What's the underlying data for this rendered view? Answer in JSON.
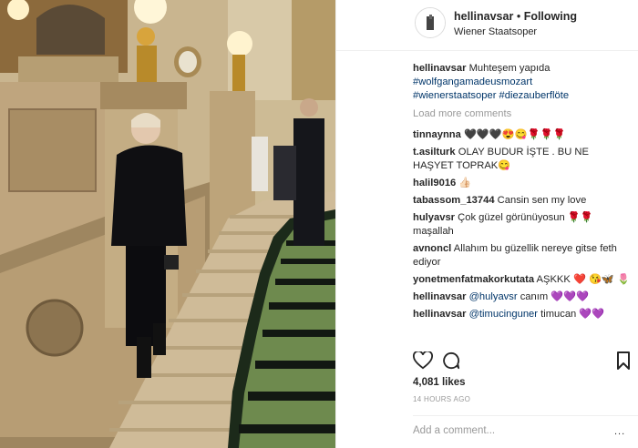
{
  "post": {
    "username": "hellinavsar",
    "separator": "•",
    "follow_status": "Following",
    "location": "Wiener Staatsoper"
  },
  "caption": {
    "username": "hellinavsar",
    "text": "Muhteşem yapıda",
    "hashtags": [
      "#wolfgangamadeusmozart",
      "#wienerstaatsoper",
      "#diezauberflöte"
    ]
  },
  "load_more": "Load more comments",
  "comments": [
    {
      "username": "tinnaynna",
      "text": "🖤🖤🖤😍😋🌹🌹🌹"
    },
    {
      "username": "t.asilturk",
      "text": "OLAY BUDUR İŞTE . BU NE HAŞYET TOPRAK😋"
    },
    {
      "username": "halil9016",
      "text": "👍🏻"
    },
    {
      "username": "tabassom_13744",
      "text": "Cansin sen my love"
    },
    {
      "username": "hulyavsr",
      "text": "Çok güzel görünüyosun 🌹🌹 maşallah"
    },
    {
      "username": "avnoncl",
      "text": "Allahım bu güzellik nereye gitse feth ediyor"
    },
    {
      "username": "yonetmenfatmakorkutata",
      "text": "AŞKKK ❤️ 😘🦋 🌷"
    },
    {
      "username": "hellinavsar",
      "mention": "@hulyavsr",
      "text": "canım 💜💜💜"
    },
    {
      "username": "hellinavsar",
      "mention": "@timucinguner",
      "text": "timucan 💜💜"
    }
  ],
  "likes": "4,081 likes",
  "timestamp": "14 HOURS AGO",
  "add_comment_placeholder": "Add a comment...",
  "more_options": "...",
  "icons": [
    "heart-icon",
    "comment-icon",
    "bookmark-icon",
    "more-options-icon"
  ]
}
